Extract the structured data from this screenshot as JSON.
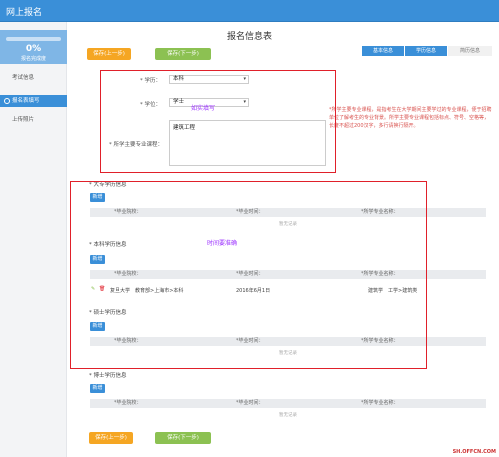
{
  "header": {
    "brand": "网上报名"
  },
  "sidebar": {
    "progress_value": "0%",
    "progress_fraction": 0.0,
    "progress_label": "报名完成度",
    "items": [
      {
        "label": "考试信息"
      },
      {
        "label": "报名表填写"
      },
      {
        "label": "上传照片"
      }
    ]
  },
  "page": {
    "title": "报名信息表"
  },
  "actions": {
    "prev_label": "保存(上一步)",
    "next_label": "保存(下一步)"
  },
  "steps": [
    {
      "label": "基本信息"
    },
    {
      "label": "学历信息"
    },
    {
      "label": "简历信息"
    }
  ],
  "form": {
    "degree_label": "* 学历：",
    "degree_value": "本科",
    "degree_caret": "▾",
    "diploma_label": "* 学位：",
    "diploma_value": "学士",
    "diploma_caret": "▾",
    "major_label": "* 所学主要专业课程：",
    "major_value": "建筑工程",
    "hint": "*所学主要专业课程，是指考生在大学期间主要学过的专业课程，便于招聘单位了解考生的专业背景。所学主要专业课程包括标点、符号、空格等，长度不超过200汉字，多行请换行隔开。",
    "annotation_fill": "如实填写"
  },
  "education": {
    "annotation_time": "时间要准确",
    "add_label": "新增",
    "columns": [
      "*毕业院校：",
      "*毕业时间：",
      "*所学专业名称："
    ],
    "empty_text": "暂无记录",
    "sections": [
      {
        "title": "* 大专学历信息"
      },
      {
        "title": "* 本科学历信息"
      },
      {
        "title": "* 硕士学历信息"
      },
      {
        "title": "* 博士学历信息"
      }
    ],
    "bachelor_row": {
      "school": "复旦大学　教育部>上海市>本科",
      "time": "2016年6月1日",
      "major": "建筑学　工学>建筑类"
    }
  },
  "footer": {
    "watermark": "SH.OFFCN.COM"
  }
}
